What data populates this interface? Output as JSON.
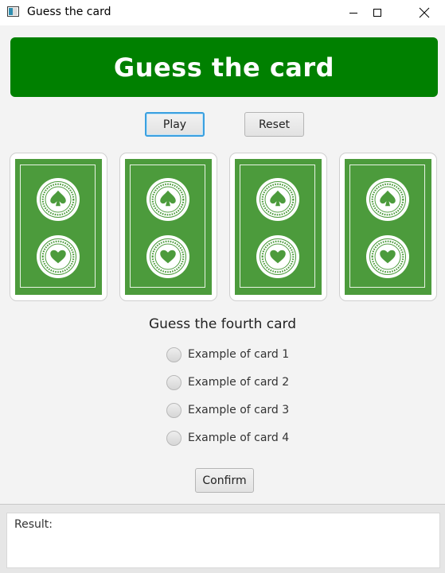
{
  "window": {
    "title": "Guess the card",
    "controls": [
      "minimize-icon",
      "maximize-icon",
      "close-icon"
    ]
  },
  "header": {
    "title": "Guess the card",
    "background": "#008000",
    "text_color": "#ffffff"
  },
  "actions": {
    "play_label": "Play",
    "reset_label": "Reset"
  },
  "cards": [
    {
      "state": "face-down",
      "emblems": [
        "spade",
        "heart"
      ]
    },
    {
      "state": "face-down",
      "emblems": [
        "spade",
        "heart"
      ]
    },
    {
      "state": "face-down",
      "emblems": [
        "spade",
        "heart"
      ]
    },
    {
      "state": "face-down",
      "emblems": [
        "spade",
        "heart"
      ]
    }
  ],
  "card_back_color": "#4c9b3c",
  "guess": {
    "prompt": "Guess the fourth card",
    "options": [
      {
        "label": "Example of card 1",
        "selected": false
      },
      {
        "label": "Example of card 2",
        "selected": false
      },
      {
        "label": "Example of card 3",
        "selected": false
      },
      {
        "label": "Example of card 4",
        "selected": false
      }
    ],
    "confirm_label": "Confirm"
  },
  "result": {
    "label": "Result:",
    "value": ""
  }
}
